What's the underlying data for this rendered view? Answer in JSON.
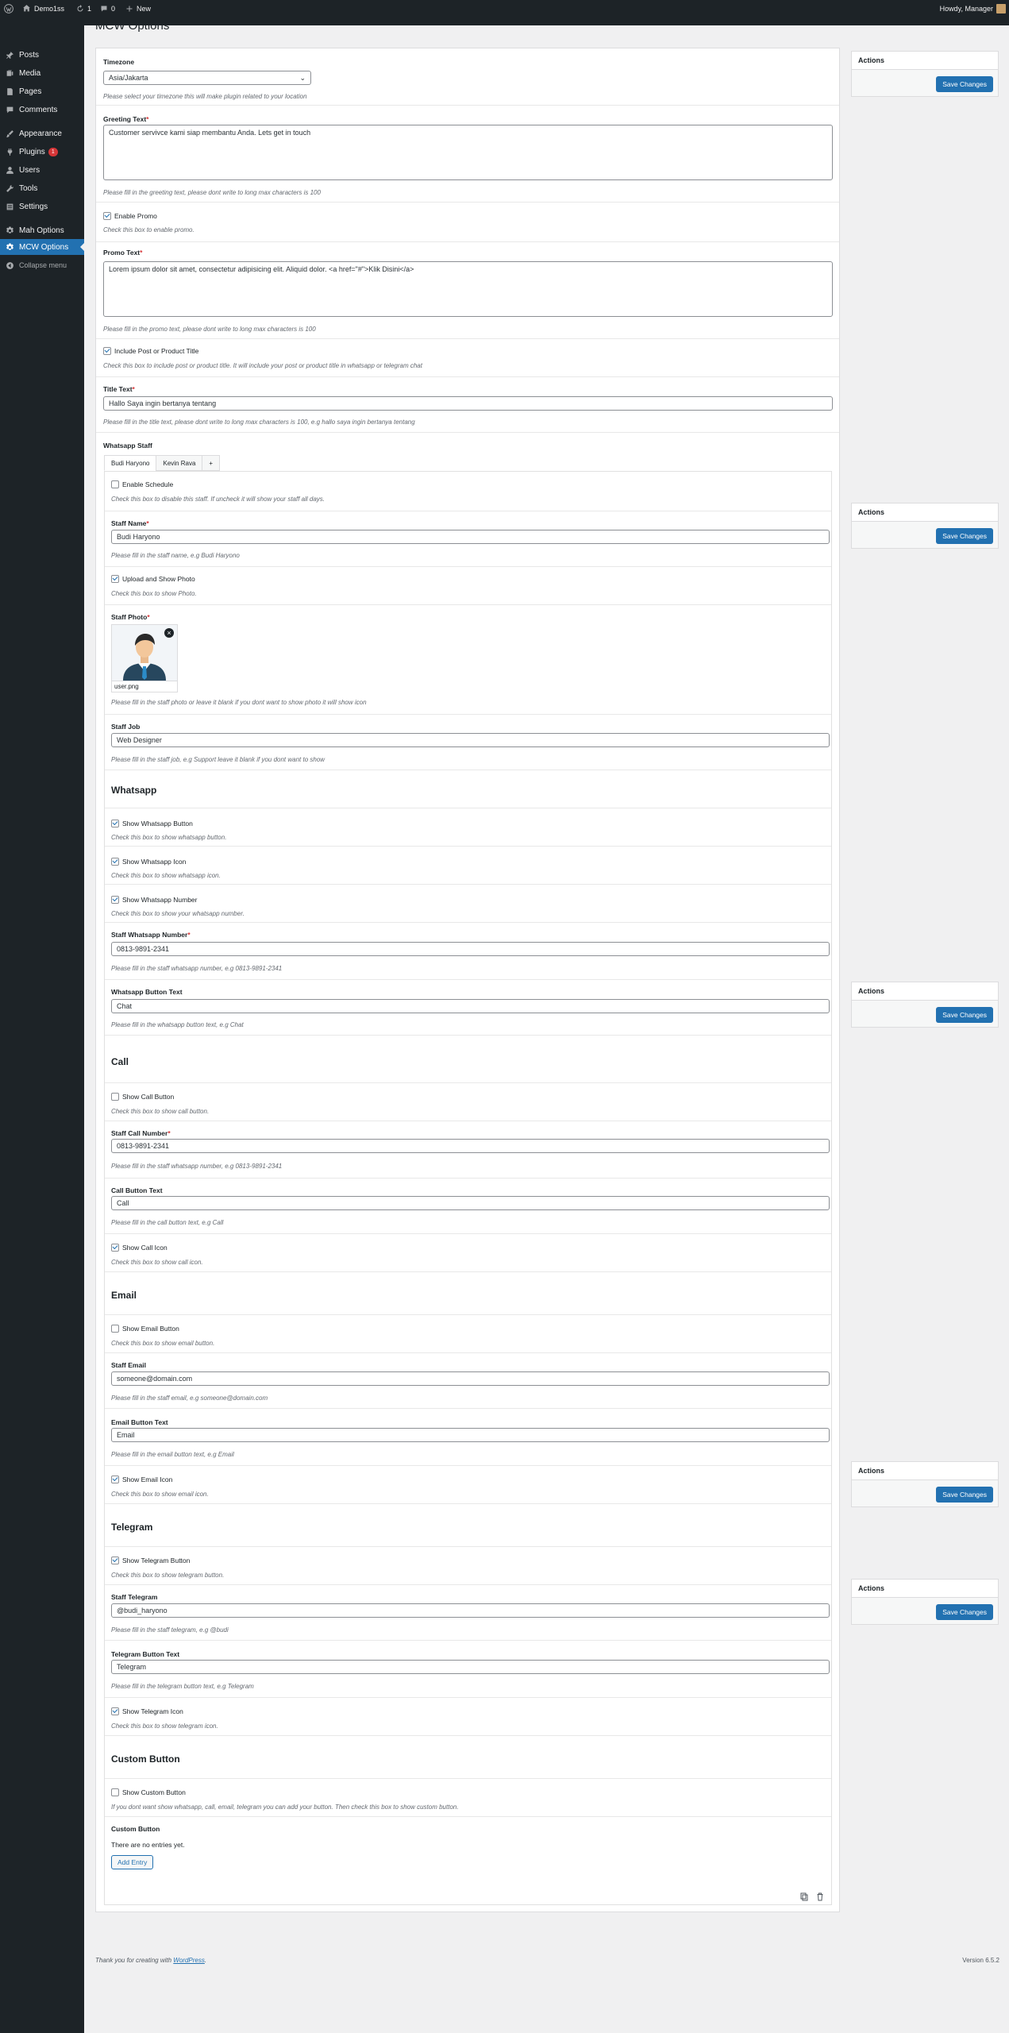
{
  "adminbar": {
    "site": "Demo1ss",
    "updates": "1",
    "comments": "0",
    "new": "New",
    "howdy": "Howdy, Manager"
  },
  "sidebar": {
    "items": [
      {
        "label": "Posts",
        "icon": "pin-icon"
      },
      {
        "label": "Media",
        "icon": "media-icon"
      },
      {
        "label": "Pages",
        "icon": "page-icon"
      },
      {
        "label": "Comments",
        "icon": "comment-icon"
      },
      {
        "label": "Appearance",
        "icon": "brush-icon"
      },
      {
        "label": "Plugins",
        "icon": "plugin-icon",
        "badge": "1"
      },
      {
        "label": "Users",
        "icon": "user-icon"
      },
      {
        "label": "Tools",
        "icon": "wrench-icon"
      },
      {
        "label": "Settings",
        "icon": "settings-icon"
      },
      {
        "label": "Mah Options",
        "icon": "gear-icon"
      },
      {
        "label": "MCW Options",
        "icon": "gear-icon"
      },
      {
        "label": "Collapse menu",
        "icon": "collapse-icon"
      }
    ]
  },
  "page": {
    "title": "MCW Options"
  },
  "timezone": {
    "label": "Timezone",
    "value": "Asia/Jakarta",
    "hint": "Please select your timezone this will make plugin related to your location"
  },
  "greeting": {
    "label": "Greeting Text",
    "req": "*",
    "value": "Customer servivce kami siap membantu Anda. Lets get in touch",
    "hint": "Please fill in the greeting text, please dont write to long max characters is 100"
  },
  "promo_toggle": {
    "label": "Enable Promo",
    "hint": "Check this box to enable promo."
  },
  "promo_text": {
    "label": "Promo Text",
    "req": "*",
    "value": "Lorem ipsum dolor sit amet, consectetur adipisicing elit. Aliquid dolor. <a href=\"#\">Klik Disini</a>",
    "hint": "Please fill in the promo text, please dont write to long max characters is 100"
  },
  "include_title": {
    "label": "Include Post or Product Title",
    "hint": "Check this box to include post or product title. It will include your post or product title in whatsapp or telegram chat"
  },
  "title_text": {
    "label": "Title Text",
    "req": "*",
    "value": "Hallo Saya ingin bertanya tentang",
    "hint": "Please fill in the title text, please dont write to long max characters is 100, e.g hallo saya ingin bertanya tentang"
  },
  "staff": {
    "label": "Whatsapp Staff",
    "tabs": [
      "Budi Haryono",
      "Kevin Rava",
      "+"
    ],
    "schedule": {
      "label": "Enable Schedule",
      "hint": "Check this box to disable this staff. If uncheck it will show your staff all days."
    },
    "name": {
      "label": "Staff Name",
      "req": "*",
      "value": "Budi Haryono",
      "hint": "Please fill in the staff name, e.g Budi Haryono"
    },
    "upload_photo": {
      "label": "Upload and Show Photo",
      "hint": "Check this box to show Photo."
    },
    "photo": {
      "label": "Staff Photo",
      "req": "*",
      "filename": "user.png",
      "hint": "Please fill in the staff photo or leave it blank if you dont want to show photo it will show icon"
    },
    "job": {
      "label": "Staff Job",
      "value": "Web Designer",
      "hint": "Please fill in the staff job, e.g Support leave it blank if you dont want to show"
    },
    "whatsapp": {
      "heading": "Whatsapp",
      "show_button": {
        "label": "Show Whatsapp Button",
        "hint": "Check this box to show whatsapp button."
      },
      "show_icon": {
        "label": "Show Whatsapp Icon",
        "hint": "Check this box to show whatsapp icon."
      },
      "show_number": {
        "label": "Show Whatsapp Number",
        "hint": "Check this box to show your whatsapp number."
      },
      "number": {
        "label": "Staff Whatsapp Number",
        "req": "*",
        "value": "0813-9891-2341",
        "hint": "Please fill in the staff whatsapp number, e.g 0813-9891-2341"
      },
      "button_text": {
        "label": "Whatsapp Button Text",
        "value": "Chat",
        "hint": "Please fill in the whatsapp button text, e.g Chat"
      }
    },
    "call": {
      "heading": "Call",
      "show_button": {
        "label": "Show Call Button",
        "hint": "Check this box to show call button."
      },
      "number": {
        "label": "Staff Call Number",
        "req": "*",
        "value": "0813-9891-2341",
        "hint": "Please fill in the staff whatsapp number, e.g 0813-9891-2341"
      },
      "button_text": {
        "label": "Call Button Text",
        "value": "Call",
        "hint": "Please fill in the call button text, e.g Call"
      },
      "show_icon": {
        "label": "Show Call Icon",
        "hint": "Check this box to show call icon."
      }
    },
    "email": {
      "heading": "Email",
      "show_button": {
        "label": "Show Email Button",
        "hint": "Check this box to show email button."
      },
      "address": {
        "label": "Staff Email",
        "value": "someone@domain.com",
        "hint": "Please fill in the staff email, e.g someone@domain.com"
      },
      "button_text": {
        "label": "Email Button Text",
        "value": "Email",
        "hint": "Please fill in the email button text, e.g Email"
      },
      "show_icon": {
        "label": "Show Email Icon",
        "hint": "Check this box to show email icon."
      }
    },
    "telegram": {
      "heading": "Telegram",
      "show_button": {
        "label": "Show Telegram Button",
        "hint": "Check this box to show telegram button."
      },
      "username": {
        "label": "Staff Telegram",
        "value": "@budi_haryono",
        "hint": "Please fill in the staff telegram, e.g @budi"
      },
      "button_text": {
        "label": "Telegram Button Text",
        "value": "Telegram",
        "hint": "Please fill in the telegram button text, e.g Telegram"
      },
      "show_icon": {
        "label": "Show Telegram Icon",
        "hint": "Check this box to show telegram icon."
      }
    },
    "custom": {
      "heading": "Custom Button",
      "show_button": {
        "label": "Show Custom Button",
        "hint": "If you dont want show whatsapp, call, email, telegram you can add your button. Then check this box to show custom button."
      },
      "list_label": "Custom Button",
      "empty": "There are no entries yet.",
      "add": "Add Entry"
    }
  },
  "actions": {
    "title": "Actions",
    "save": "Save Changes"
  },
  "footer": {
    "thanks": "Thank you for creating with",
    "link": "WordPress",
    "period": ".",
    "version": "Version 6.5.2"
  },
  "colors": {
    "primary": "#2271b1",
    "sidebar": "#1d2327",
    "danger": "#d63638"
  }
}
